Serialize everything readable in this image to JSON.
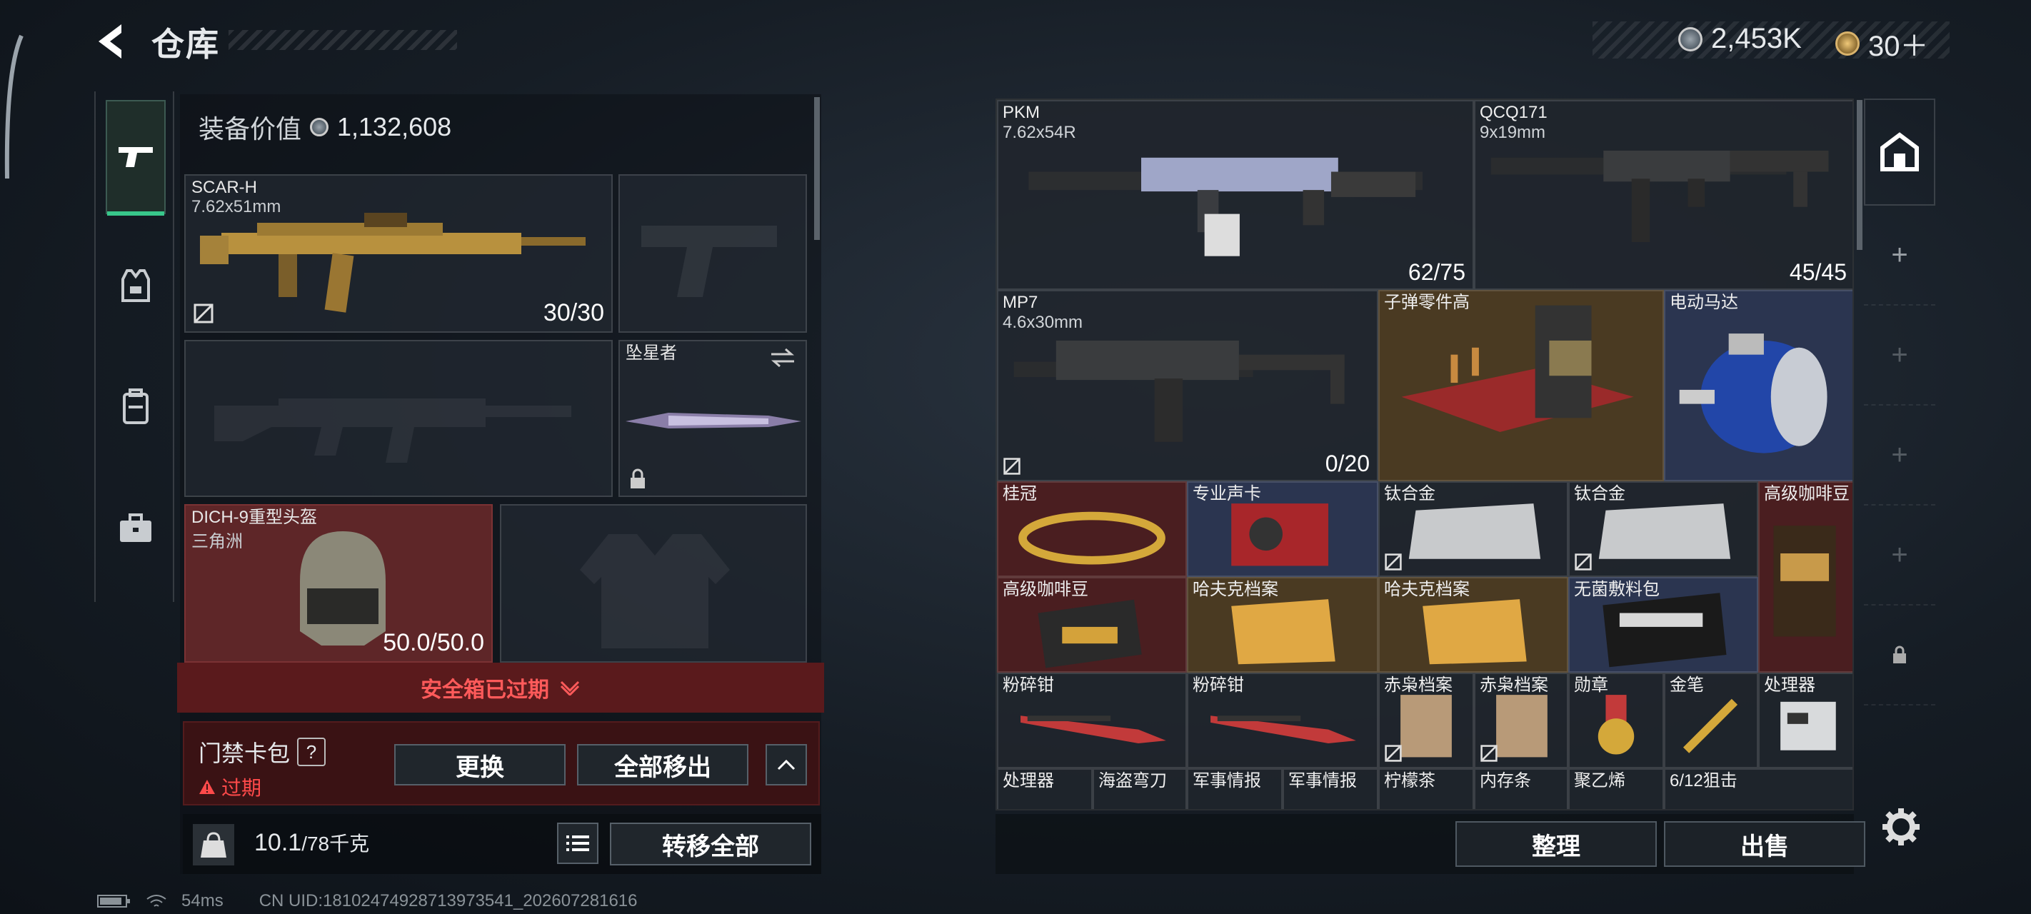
{
  "header": {
    "title": "仓库",
    "currency_silver": "2,453K",
    "currency_gold": "30＋"
  },
  "equipment": {
    "value_label": "装备价值",
    "value": "1,132,608",
    "primary": {
      "name": "SCAR-H",
      "caliber": "7.62x51mm",
      "ammo": "30/30"
    },
    "melee": {
      "name": "坠星者"
    },
    "helmet": {
      "name": "DICH-9重型头盔",
      "sub": "三角洲",
      "durability": "50.0/50.0"
    }
  },
  "safe_box": {
    "label": "安全箱已过期"
  },
  "card_pack": {
    "title": "门禁卡包",
    "help": "?",
    "status": "过期",
    "replace_label": "更换",
    "remove_all_label": "全部移出"
  },
  "weight": {
    "current": "10.1",
    "max": "/78千克",
    "transfer_all_label": "转移全部",
    "kg_icon_text": "KG"
  },
  "stash": {
    "items": [
      {
        "name": "PKM",
        "sub": "7.62x54R",
        "count": "62/75"
      },
      {
        "name": "QCQ171",
        "sub": "9x19mm",
        "count": "45/45"
      },
      {
        "name": "MP7",
        "sub": "4.6x30mm",
        "count": "0/20"
      },
      {
        "name": "子弹零件高"
      },
      {
        "name": "电动马达"
      },
      {
        "name": "桂冠"
      },
      {
        "name": "专业声卡"
      },
      {
        "name": "钛合金"
      },
      {
        "name": "钛合金"
      },
      {
        "name": "高级咖啡豆"
      },
      {
        "name": "高级咖啡豆"
      },
      {
        "name": "哈夫克档案"
      },
      {
        "name": "哈夫克档案"
      },
      {
        "name": "无菌敷料包"
      },
      {
        "name": "粉碎钳"
      },
      {
        "name": "粉碎钳"
      },
      {
        "name": "赤枭档案"
      },
      {
        "name": "赤枭档案"
      },
      {
        "name": "勋章"
      },
      {
        "name": "金笔"
      },
      {
        "name": "处理器"
      },
      {
        "name": "处理器"
      },
      {
        "name": "海盗弯刀"
      },
      {
        "name": "军事情报"
      },
      {
        "name": "军事情报"
      },
      {
        "name": "柠檬茶"
      },
      {
        "name": "内存条"
      },
      {
        "name": "聚乙烯"
      },
      {
        "name": "6/12狙击"
      }
    ],
    "sort_label": "整理",
    "sell_label": "出售"
  },
  "status_bar": {
    "ping": "54ms",
    "uid": "CN UID:181024749287139735​41_202607281616"
  },
  "colors": {
    "accent_green": "#38c78b",
    "warning_red": "#ff4a4a",
    "panel_red": "#5a1a1c"
  }
}
